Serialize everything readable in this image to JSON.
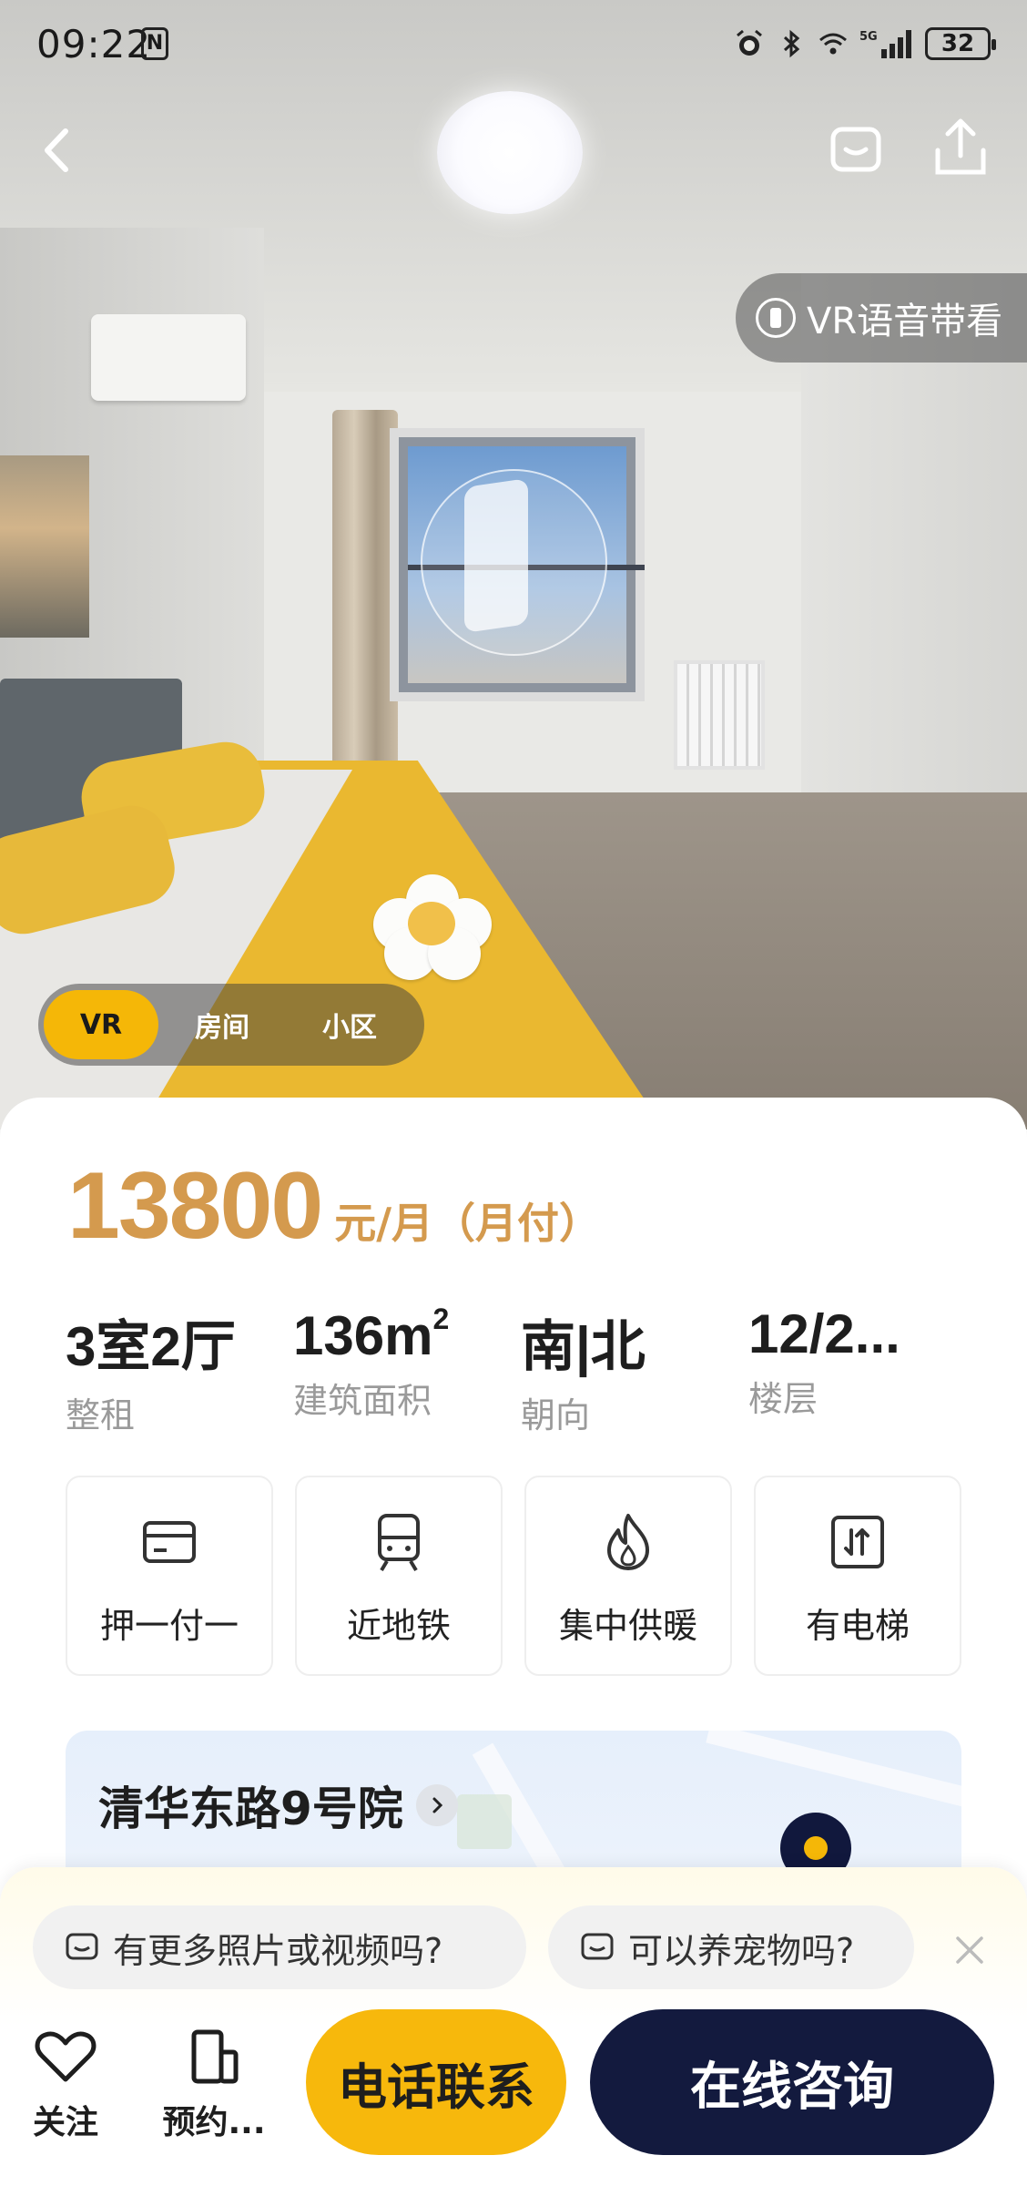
{
  "status_bar": {
    "time": "09:22",
    "nfc_label": "N",
    "network": "5G",
    "battery": "32"
  },
  "hero": {
    "vr_voice_label": "VR语音带看",
    "mode_tabs": [
      {
        "label": "VR",
        "active": true
      },
      {
        "label": "房间",
        "active": false
      },
      {
        "label": "小区",
        "active": false
      }
    ]
  },
  "listing": {
    "price": "13800",
    "price_unit": "元/月（月付）",
    "attributes": [
      {
        "value": "3室2厅",
        "label": "整租"
      },
      {
        "value": "136m",
        "sup": "2",
        "label": "建筑面积"
      },
      {
        "value": "南|北",
        "label": "朝向"
      },
      {
        "value": "12/2...",
        "label": "楼层"
      }
    ],
    "features": [
      {
        "icon": "card-icon",
        "label": "押一付一"
      },
      {
        "icon": "subway-icon",
        "label": "近地铁"
      },
      {
        "icon": "flame-icon",
        "label": "集中供暖"
      },
      {
        "icon": "elevator-icon",
        "label": "有电梯"
      }
    ],
    "community": {
      "name": "清华东路9号院"
    }
  },
  "quick_questions": [
    "有更多照片或视频吗?",
    "可以养宠物吗?"
  ],
  "actions": {
    "follow_label": "关注",
    "book_label": "预约...",
    "call_label": "电话联系",
    "chat_label": "在线咨询"
  },
  "colors": {
    "accent_yellow": "#f5b707",
    "price_color": "#d49a4e",
    "dark_navy": "#131a3e"
  }
}
